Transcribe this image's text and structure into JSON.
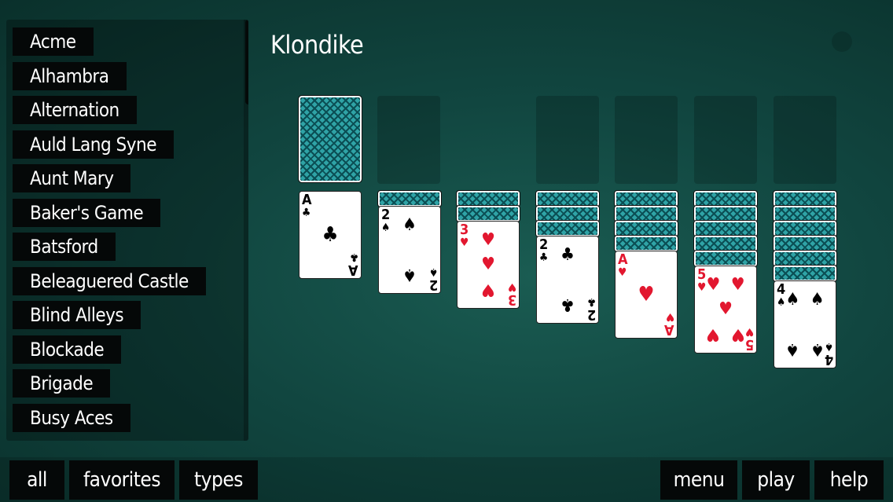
{
  "title": "Klondike",
  "game_list": [
    "Acme",
    "Alhambra",
    "Alternation",
    "Auld Lang Syne",
    "Aunt Mary",
    "Baker's Game",
    "Batsford",
    "Beleaguered Castle",
    "Blind Alleys",
    "Blockade",
    "Brigade",
    "Busy Aces"
  ],
  "bottom_left": {
    "all": "all",
    "favorites": "favorites",
    "types": "types"
  },
  "bottom_right": {
    "menu": "menu",
    "play": "play",
    "help": "help"
  },
  "colors": {
    "table": "#114640",
    "card_back": "#2fa3a6",
    "red_suit": "#e2172f",
    "button_bg": "#050808"
  },
  "stock": {
    "face_down": true
  },
  "tableau": [
    {
      "hidden": 0,
      "card": {
        "rank": "A",
        "suit": "♣",
        "color": "black"
      }
    },
    {
      "hidden": 1,
      "card": {
        "rank": "2",
        "suit": "♠",
        "color": "black"
      }
    },
    {
      "hidden": 2,
      "card": {
        "rank": "3",
        "suit": "♥",
        "color": "red"
      }
    },
    {
      "hidden": 3,
      "card": {
        "rank": "2",
        "suit": "♣",
        "color": "black"
      }
    },
    {
      "hidden": 4,
      "card": {
        "rank": "A",
        "suit": "♥",
        "color": "red"
      }
    },
    {
      "hidden": 5,
      "card": {
        "rank": "5",
        "suit": "♥",
        "color": "red"
      }
    },
    {
      "hidden": 6,
      "card": {
        "rank": "4",
        "suit": "♠",
        "color": "black"
      }
    }
  ]
}
